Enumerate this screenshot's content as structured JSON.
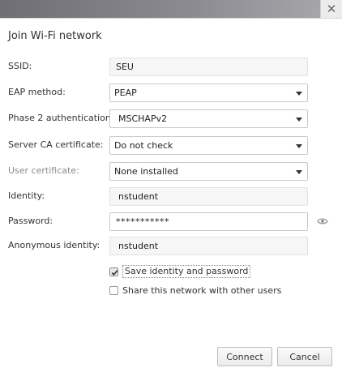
{
  "window": {
    "close_glyph": "✕"
  },
  "dialog": {
    "title": "Join Wi-Fi network",
    "ssid": {
      "label": "SSID:",
      "value": "SEU"
    },
    "eap_method": {
      "label": "EAP method:",
      "value": "PEAP"
    },
    "phase2": {
      "label": "Phase 2 authentication:",
      "value": "MSCHAPv2"
    },
    "server_ca": {
      "label": "Server CA certificate:",
      "value": "Do not check"
    },
    "user_cert": {
      "label": "User certificate:",
      "value": "None installed"
    },
    "identity": {
      "label": "Identity:",
      "value": "nstudent"
    },
    "password": {
      "label": "Password:",
      "value": "***********"
    },
    "anonymous_identity": {
      "label": "Anonymous identity:",
      "value": "nstudent"
    },
    "save_identity": {
      "label": "Save identity and password",
      "checked": true
    },
    "share_network": {
      "label": "Share this network with other users",
      "checked": false
    },
    "buttons": {
      "connect": "Connect",
      "cancel": "Cancel"
    }
  },
  "icons": {
    "close": "close-icon",
    "dropdown": "chevron-down-icon",
    "show_password": "eye-icon",
    "checkmark": "checkmark-icon"
  },
  "colors": {
    "field_bg": "#f6f6f6",
    "disabled_text": "#8a8a8a",
    "topbar": "#8a8a90"
  }
}
